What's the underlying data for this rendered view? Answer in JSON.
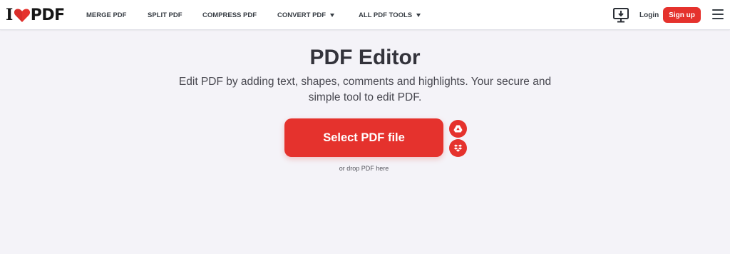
{
  "header": {
    "logo": {
      "i": "I",
      "pdf": "PDF"
    },
    "nav": [
      {
        "label": "MERGE PDF"
      },
      {
        "label": "SPLIT PDF"
      },
      {
        "label": "COMPRESS PDF"
      },
      {
        "label": "CONVERT PDF",
        "dropdown": true
      },
      {
        "label": "ALL PDF TOOLS",
        "dropdown": true
      }
    ],
    "download_icon": "desktop-download-icon",
    "login_label": "Login",
    "signup_label": "Sign up",
    "menu_icon": "hamburger-menu-icon"
  },
  "main": {
    "title": "PDF Editor",
    "subtitle": "Edit PDF by adding text, shapes, comments and highlights. Your secure and simple tool to edit PDF.",
    "select_button_label": "Select PDF file",
    "cloud_buttons": [
      {
        "icon": "google-drive-icon"
      },
      {
        "icon": "dropbox-icon"
      }
    ],
    "drop_hint": "or drop PDF here"
  },
  "colors": {
    "brand_red": "#e5322d",
    "background": "#f4f3f8",
    "header_bg": "#ffffff",
    "text_dark": "#33333b"
  }
}
